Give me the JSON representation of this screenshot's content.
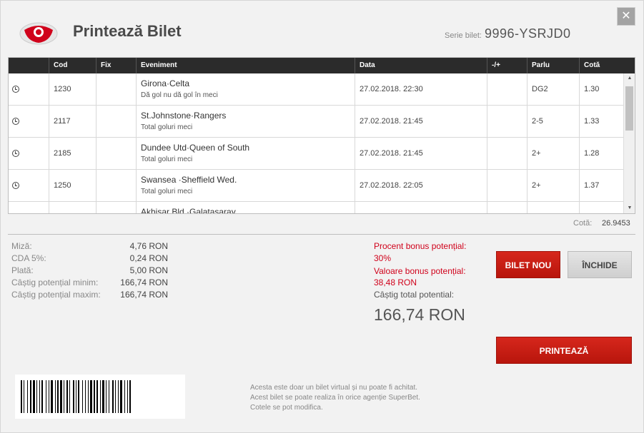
{
  "header": {
    "title": "Printează Bilet",
    "serie_label": "Serie bilet:",
    "serie_value": "9996-YSRJD0",
    "close_label": "✕"
  },
  "table": {
    "columns": [
      "Cod",
      "Fix",
      "Eveniment",
      "Data",
      "-/+",
      "Parlu",
      "Cotă"
    ],
    "rows": [
      {
        "cod": "1230",
        "fix": "",
        "event": "Girona·Celta",
        "market": "Dă gol nu dă gol în meci",
        "date": "27.02.2018. 22:30",
        "plusminus": "",
        "parlu": "DG2",
        "cota": "1.30"
      },
      {
        "cod": "2117",
        "fix": "",
        "event": "St.Johnstone·Rangers",
        "market": "Total goluri meci",
        "date": "27.02.2018. 21:45",
        "plusminus": "",
        "parlu": "2-5",
        "cota": "1.33"
      },
      {
        "cod": "2185",
        "fix": "",
        "event": "Dundee Utd·Queen of South",
        "market": "Total goluri meci",
        "date": "27.02.2018. 21:45",
        "plusminus": "",
        "parlu": "2+",
        "cota": "1.28"
      },
      {
        "cod": "1250",
        "fix": "",
        "event": "Swansea ·Sheffield Wed.",
        "market": "Total goluri meci",
        "date": "27.02.2018. 22:05",
        "plusminus": "",
        "parlu": "2+",
        "cota": "1.37"
      },
      {
        "cod": "",
        "fix": "",
        "event": "Akhisar Bld.·Galatasaray",
        "market": "",
        "date": "",
        "plusminus": "",
        "parlu": "",
        "cota": ""
      }
    ]
  },
  "cota_total": {
    "label": "Cotă:",
    "value": "26.9453"
  },
  "summary": {
    "miza_label": "Miză:",
    "miza_value": "4,76 RON",
    "cda_label": "CDA 5%:",
    "cda_value": "0,24 RON",
    "plata_label": "Plată:",
    "plata_value": "5,00 RON",
    "min_label": "Câștig potențial minim:",
    "min_value": "166,74 RON",
    "max_label": "Câștig potențial maxim:",
    "max_value": "166,74 RON"
  },
  "bonus": {
    "procent_label": "Procent bonus potențial:",
    "procent_value": "30%",
    "valoare_label": "Valoare bonus potențial:",
    "valoare_value": "38,48 RON",
    "total_label": "Câștig total potential:",
    "total_value": "166,74 RON"
  },
  "buttons": {
    "bilet_nou": "BILET NOU",
    "inchide": "ÎNCHIDE",
    "printeaza": "PRINTEAZĂ"
  },
  "disclaimer": [
    "Acesta este doar un bilet virtual și nu poate fi achitat.",
    "Acest bilet se poate realiza în orice agenție SuperBet.",
    "Cotele se pot modifica."
  ],
  "colors": {
    "accent_red": "#d0021b",
    "header_dark": "#2b2b2b"
  },
  "icons": {
    "logo": "superbet-logo",
    "row_icon": "clock-icon",
    "close": "close-icon"
  }
}
